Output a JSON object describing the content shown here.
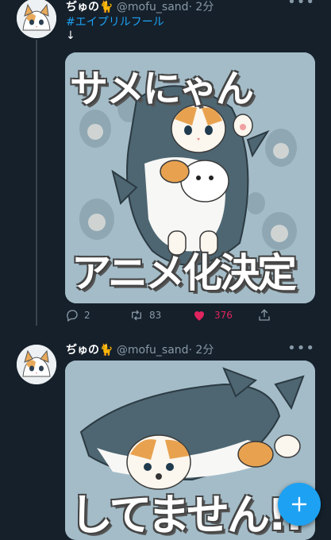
{
  "tweets": [
    {
      "author_name": "ぢゅの🐈",
      "handle": "@mofu_sand",
      "time": "· 2分",
      "hashtag": "#エイプリルフール",
      "arrow": "↓",
      "image_text_top": "サメにゃん",
      "image_text_bottom": "アニメ化決定",
      "replies": "2",
      "retweets": "83",
      "likes": "376",
      "more": "•••"
    },
    {
      "author_name": "ぢゅの🐈",
      "handle": "@mofu_sand",
      "time": "· 2分",
      "image_text_bottom": "してません!!",
      "more": "•••"
    }
  ],
  "icons": {
    "reply": "reply-icon",
    "retweet": "retweet-icon",
    "like": "heart-icon",
    "share": "share-icon",
    "compose": "compose-plus-icon"
  },
  "colors": {
    "background": "#15202b",
    "accent": "#1da1f2",
    "like": "#e0245e",
    "muted": "#8899a6"
  }
}
